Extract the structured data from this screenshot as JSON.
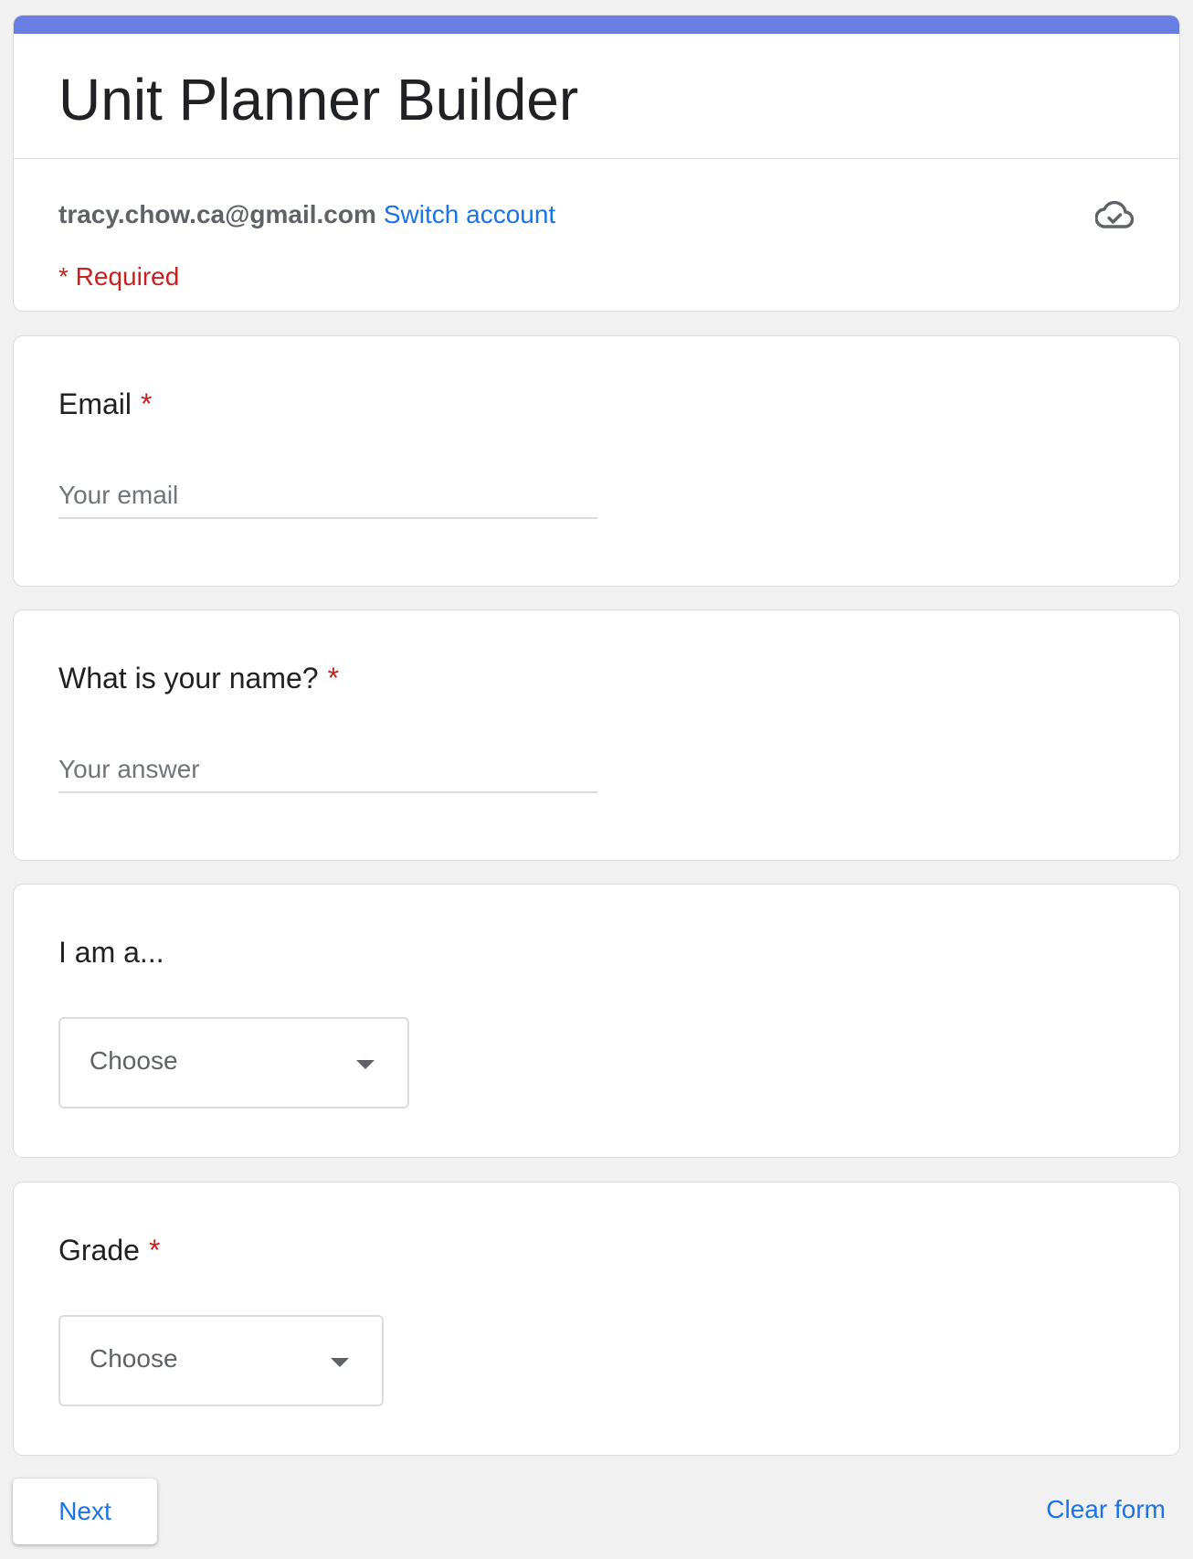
{
  "form": {
    "title": "Unit Planner Builder",
    "accent_color": "#6a7fe3"
  },
  "account": {
    "email": "tracy.chow.ca@gmail.com",
    "switch_label": "Switch account",
    "saved_icon": "cloud-check-icon"
  },
  "required_note": "* Required",
  "questions": {
    "email": {
      "label": "Email",
      "required_mark": "*",
      "placeholder": "Your email"
    },
    "name": {
      "label": "What is your name?",
      "required_mark": "*",
      "placeholder": "Your answer"
    },
    "role": {
      "label": "I am a...",
      "selected": "Choose"
    },
    "grade": {
      "label": "Grade",
      "required_mark": "*",
      "selected": "Choose"
    }
  },
  "footer": {
    "next_label": "Next",
    "clear_label": "Clear form"
  },
  "colors": {
    "link": "#1a73e8",
    "required": "#c5221f",
    "background": "#f1f1f1"
  }
}
